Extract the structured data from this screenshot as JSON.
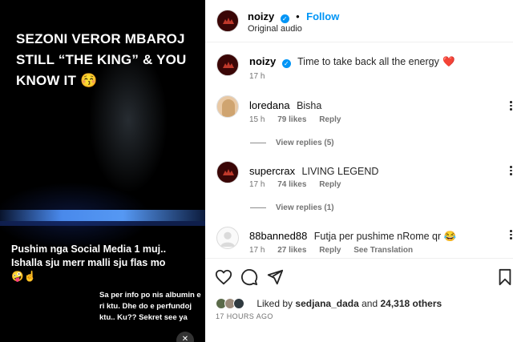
{
  "media": {
    "title_overlay": "SEZONI VEROR MBAROJ STILL “THE KING” & YOU KNOW IT 😚",
    "mid_overlay": "Pushim nga Social Media 1 muj.. Ishalla sju merr malli sju flas mo 🤪☝️",
    "small_overlay": "Sa per info po nis albumin e ri ktu. Dhe do e perfundoj ktu.. Ku?? Sekret see ya",
    "mute_icon": "speaker-muted-icon"
  },
  "header": {
    "username": "noizy",
    "separator": "•",
    "follow_label": "Follow",
    "audio_label": "Original audio"
  },
  "caption": {
    "username": "noizy",
    "text": "Time to take back all the energy",
    "emoji": "❤️",
    "time": "17 h"
  },
  "comments": [
    {
      "username": "loredana",
      "text": "Bisha",
      "time": "15 h",
      "likes": "79 likes",
      "reply": "Reply",
      "view_replies": "View replies (5)",
      "avatar_color": "#e9c9a5"
    },
    {
      "username": "supercrax",
      "text": "LIVING LEGEND",
      "time": "17 h",
      "likes": "74 likes",
      "reply": "Reply",
      "view_replies": "View replies (1)",
      "avatar_color": "#3a0606"
    },
    {
      "username": "88banned88",
      "text": "Futja per pushime nRome qr 😂",
      "time": "17 h",
      "likes": "27 likes",
      "reply": "Reply",
      "see_translation": "See Translation",
      "avatar_color": "#dbdbdb"
    }
  ],
  "actions": {
    "like_icon": "heart-icon",
    "comment_icon": "comment-icon",
    "share_icon": "share-icon",
    "save_icon": "bookmark-icon"
  },
  "likes": {
    "prefix": "Liked by",
    "user": "sedjana_dada",
    "middle": "and",
    "count": "24,318 others"
  },
  "posted_ago": "17 HOURS AGO",
  "colors": {
    "accent": "#0095f6",
    "heart": "#ed4956",
    "text": "#262626",
    "muted": "#737373"
  }
}
